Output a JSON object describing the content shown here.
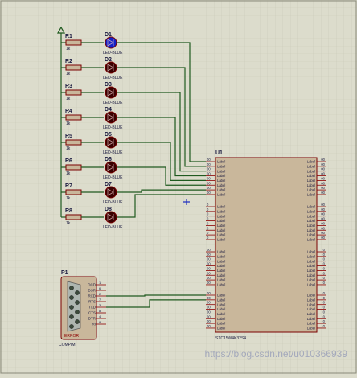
{
  "colors": {
    "background": "#dcdccc",
    "grid": "#c9c9b7",
    "wire": "#1f5a1f",
    "component_outline": "#7a0000",
    "ic_fill": "#c9b79b",
    "led_dark": "#3a0000",
    "led_active": "#1420c8",
    "text_dark": "#1a1a40",
    "pin_red": "#8b0000"
  },
  "resistors": [
    {
      "ref": "R1",
      "value": "1k"
    },
    {
      "ref": "R2",
      "value": "1k"
    },
    {
      "ref": "R3",
      "value": "1k"
    },
    {
      "ref": "R4",
      "value": "1k"
    },
    {
      "ref": "R5",
      "value": "1k"
    },
    {
      "ref": "R6",
      "value": "1k"
    },
    {
      "ref": "R7",
      "value": "1k"
    },
    {
      "ref": "R8",
      "value": "1k"
    }
  ],
  "leds": [
    {
      "ref": "D1",
      "label": "LED-BLUE",
      "lit": true
    },
    {
      "ref": "D2",
      "label": "LED-BLUE",
      "lit": false
    },
    {
      "ref": "D3",
      "label": "LED-BLUE",
      "lit": false
    },
    {
      "ref": "D4",
      "label": "LED-BLUE",
      "lit": false
    },
    {
      "ref": "D5",
      "label": "LED-BLUE",
      "lit": false
    },
    {
      "ref": "D6",
      "label": "LED-BLUE",
      "lit": false
    },
    {
      "ref": "D7",
      "label": "LED-BLUE",
      "lit": false
    },
    {
      "ref": "D8",
      "label": "LED-BLUE",
      "lit": false
    }
  ],
  "ic": {
    "ref": "U1",
    "part": "STC15W4K32S4",
    "groups": [
      {
        "left": [
          "Label",
          "Label",
          "Label",
          "Label",
          "Label",
          "Label",
          "Label",
          "Label"
        ],
        "right": [
          "Label",
          "Label",
          "Label",
          "Label",
          "Label",
          "Label",
          "Label",
          "Label"
        ],
        "lpins": [
          "00",
          "00",
          "00",
          "00",
          "00",
          "00",
          "00",
          "00"
        ],
        "rpins": [
          "00",
          "00",
          "00",
          "00",
          "00",
          "00",
          "00",
          "00"
        ]
      },
      {
        "left": [
          "Label",
          "Label",
          "Label",
          "Label",
          "Label",
          "Label",
          "Label",
          "Label"
        ],
        "right": [
          "Label",
          "Label",
          "Label",
          "Label",
          "Label",
          "Label",
          "Label",
          "Label"
        ],
        "lpins": [
          "0",
          "0",
          "0",
          "0",
          "0",
          "0",
          "0",
          "0"
        ],
        "rpins": [
          "00",
          "00",
          "00",
          "00",
          "00",
          "00",
          "00",
          "00"
        ]
      },
      {
        "left": [
          "Label",
          "Label",
          "Label",
          "Label",
          "Label",
          "Label",
          "Label",
          "Label"
        ],
        "right": [
          "Label",
          "Label",
          "Label",
          "Label",
          "Label",
          "Label",
          "Label",
          "Label"
        ],
        "lpins": [
          "00",
          "00",
          "00",
          "00",
          "00",
          "00",
          "00",
          "00"
        ],
        "rpins": [
          "0",
          "0",
          "0",
          "0",
          "0",
          "0",
          "0",
          "0"
        ]
      },
      {
        "left": [
          "Label",
          "Label",
          "Label",
          "Label",
          "Label",
          "Label",
          "Label",
          "Label"
        ],
        "right": [
          "Label",
          "Label",
          "Label",
          "Label",
          "Label",
          "Label",
          "Label",
          "Label"
        ],
        "lpins": [
          "00",
          "00",
          "00",
          "00",
          "00",
          "00",
          "00",
          "00"
        ],
        "rpins": [
          "0",
          "0",
          "0",
          "0",
          "0",
          "0",
          "0",
          "0"
        ]
      }
    ]
  },
  "connector": {
    "ref": "P1",
    "part": "COMPIM",
    "footer": "ERROR",
    "pins": [
      "DCD",
      "DSR",
      "RXD",
      "RTS",
      "TXD",
      "CTS",
      "DTR",
      "RI"
    ],
    "pin_numbers": [
      "1",
      "6",
      "2",
      "7",
      "3",
      "8",
      "4",
      "9"
    ]
  },
  "watermark": "https://blog.csdn.net/u010366939"
}
